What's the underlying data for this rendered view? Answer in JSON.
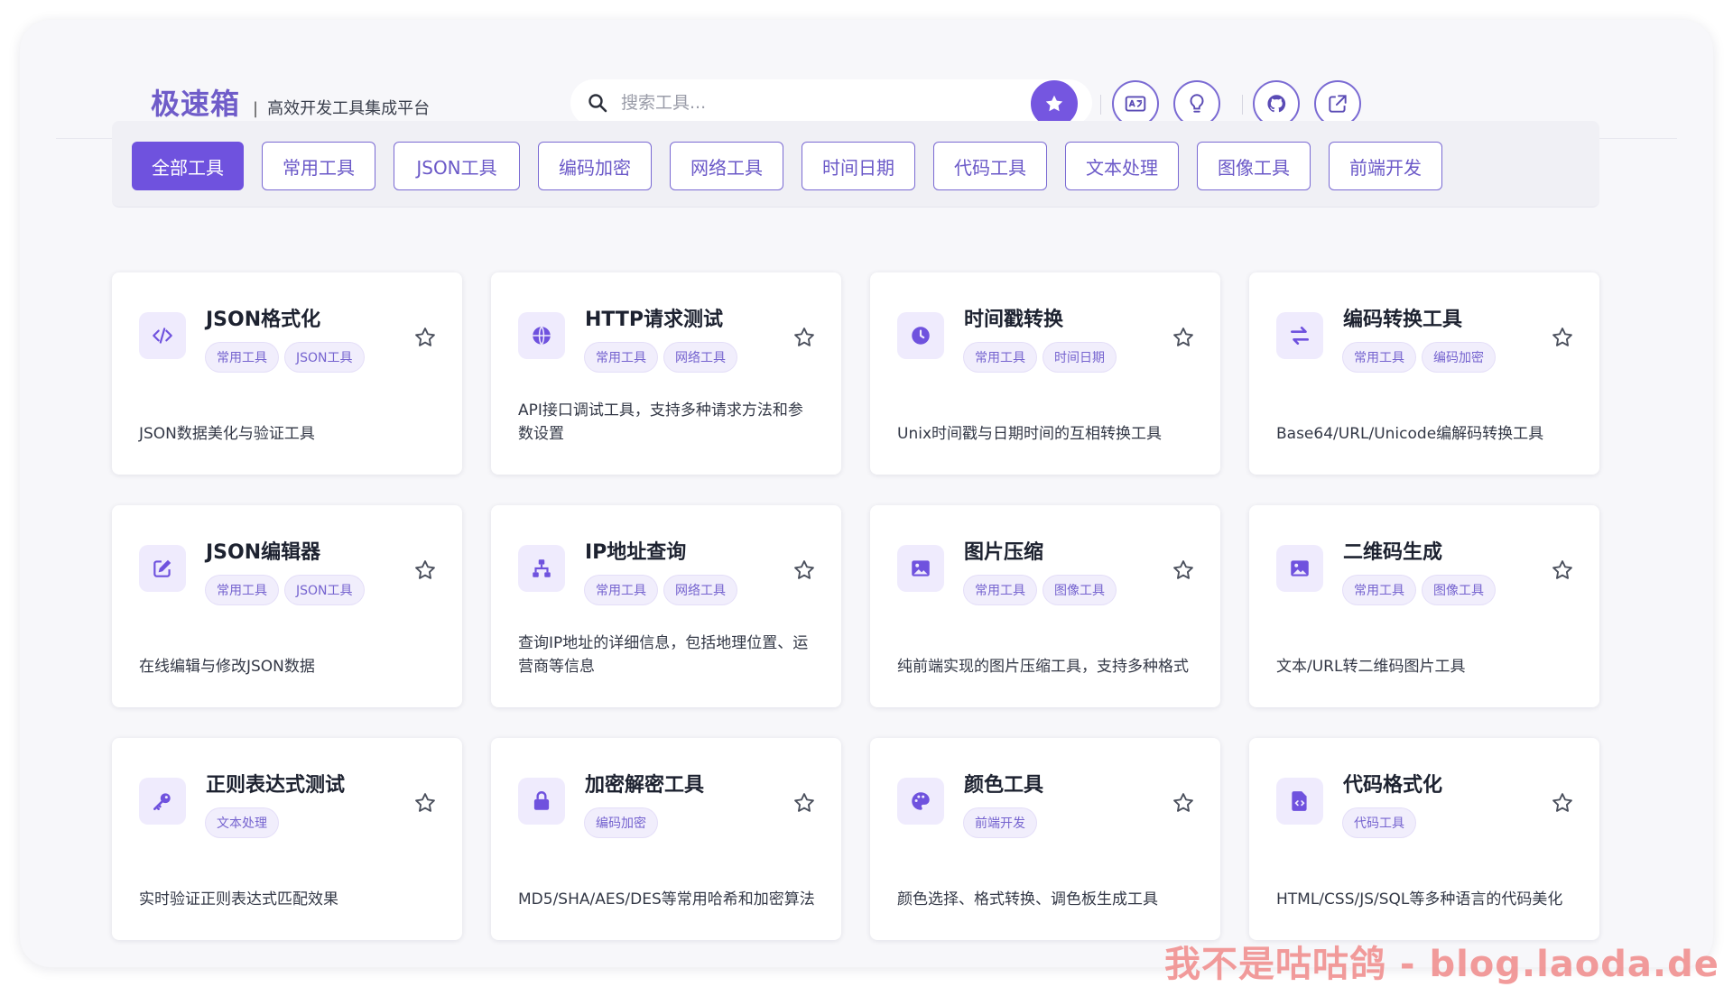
{
  "brand": {
    "name": "极速箱",
    "separator": "|",
    "subtitle": "高效开发工具集成平台"
  },
  "search": {
    "placeholder": "搜索工具..."
  },
  "header_actions": [
    "star-icon",
    "translate-icon",
    "lightbulb-icon",
    "github-icon",
    "share-icon"
  ],
  "colors": {
    "accent": "#6f52de",
    "tag_bg": "#f1eefc",
    "tag_text": "#7563cf",
    "icon_bg": "#efebfd"
  },
  "categories": [
    {
      "label": "全部工具",
      "active": true
    },
    {
      "label": "常用工具",
      "active": false
    },
    {
      "label": "JSON工具",
      "active": false
    },
    {
      "label": "编码加密",
      "active": false
    },
    {
      "label": "网络工具",
      "active": false
    },
    {
      "label": "时间日期",
      "active": false
    },
    {
      "label": "代码工具",
      "active": false
    },
    {
      "label": "文本处理",
      "active": false
    },
    {
      "label": "图像工具",
      "active": false
    },
    {
      "label": "前端开发",
      "active": false
    }
  ],
  "tools": [
    {
      "title": "JSON格式化",
      "icon": "code-icon",
      "tags": [
        "常用工具",
        "JSON工具"
      ],
      "desc": "JSON数据美化与验证工具"
    },
    {
      "title": "HTTP请求测试",
      "icon": "globe-icon",
      "tags": [
        "常用工具",
        "网络工具"
      ],
      "desc": "API接口调试工具，支持多种请求方法和参数设置"
    },
    {
      "title": "时间戳转换",
      "icon": "clock-icon",
      "tags": [
        "常用工具",
        "时间日期"
      ],
      "desc": "Unix时间戳与日期时间的互相转换工具"
    },
    {
      "title": "编码转换工具",
      "icon": "exchange-icon",
      "tags": [
        "常用工具",
        "编码加密"
      ],
      "desc": "Base64/URL/Unicode编解码转换工具"
    },
    {
      "title": "JSON编辑器",
      "icon": "edit-icon",
      "tags": [
        "常用工具",
        "JSON工具"
      ],
      "desc": "在线编辑与修改JSON数据"
    },
    {
      "title": "IP地址查询",
      "icon": "network-icon",
      "tags": [
        "常用工具",
        "网络工具"
      ],
      "desc": "查询IP地址的详细信息，包括地理位置、运营商等信息"
    },
    {
      "title": "图片压缩",
      "icon": "image-icon",
      "tags": [
        "常用工具",
        "图像工具"
      ],
      "desc": "纯前端实现的图片压缩工具，支持多种格式"
    },
    {
      "title": "二维码生成",
      "icon": "image-icon",
      "tags": [
        "常用工具",
        "图像工具"
      ],
      "desc": "文本/URL转二维码图片工具"
    },
    {
      "title": "正则表达式测试",
      "icon": "key-icon",
      "tags": [
        "文本处理"
      ],
      "desc": "实时验证正则表达式匹配效果"
    },
    {
      "title": "加密解密工具",
      "icon": "lock-icon",
      "tags": [
        "编码加密"
      ],
      "desc": "MD5/SHA/AES/DES等常用哈希和加密算法"
    },
    {
      "title": "颜色工具",
      "icon": "palette-icon",
      "tags": [
        "前端开发"
      ],
      "desc": "颜色选择、格式转换、调色板生成工具"
    },
    {
      "title": "代码格式化",
      "icon": "file-code-icon",
      "tags": [
        "代码工具"
      ],
      "desc": "HTML/CSS/JS/SQL等多种语言的代码美化"
    }
  ],
  "watermark": "我不是咕咕鸽 - blog.laoda.de"
}
